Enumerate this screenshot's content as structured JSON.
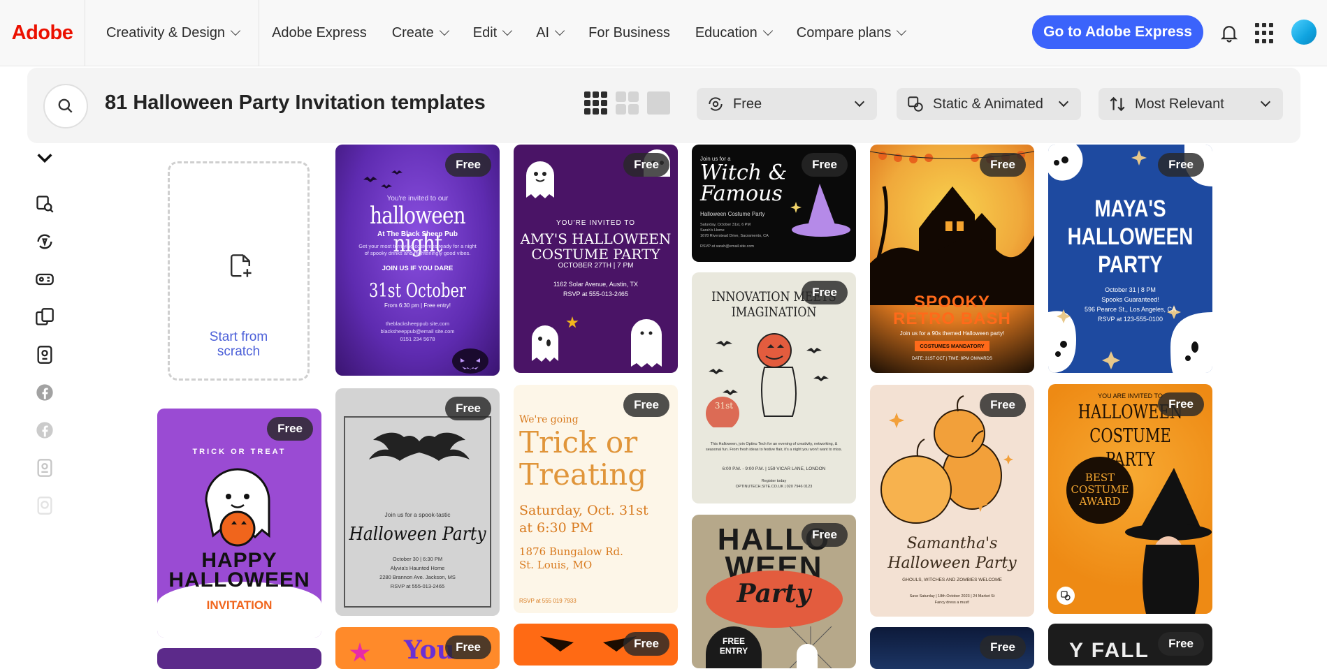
{
  "brand": {
    "logo_text": "Adobe",
    "accent": "#eb1000",
    "cta_color": "#3b63fb"
  },
  "nav": {
    "items": [
      {
        "label": "Creativity & Design",
        "has_menu": true
      },
      {
        "label": "Adobe Express",
        "has_menu": false
      },
      {
        "label": "Create",
        "has_menu": true
      },
      {
        "label": "Edit",
        "has_menu": true
      },
      {
        "label": "AI",
        "has_menu": true
      },
      {
        "label": "For Business",
        "has_menu": false
      },
      {
        "label": "Education",
        "has_menu": true
      },
      {
        "label": "Compare plans",
        "has_menu": true
      }
    ],
    "cta_label": "Go to Adobe Express",
    "icons": [
      "bell-icon",
      "app-grid-icon",
      "avatar"
    ]
  },
  "search": {
    "title": "81 Halloween Party Invitation templates",
    "view_modes": [
      "large-grid",
      "medium-grid",
      "small-grid"
    ],
    "filters": {
      "price": "Free",
      "type": "Static & Animated",
      "sort": "Most Relevant"
    }
  },
  "rail": {
    "icons": [
      "collapse-chevron-icon",
      "search-templates-icon",
      "premium-icon",
      "animated-icon",
      "template-type-icon",
      "image-icon",
      "facebook-icon",
      "facebook-alt-icon",
      "portrait-icon",
      "story-icon"
    ]
  },
  "scratch": {
    "label_line1": "Start from",
    "label_line2": "scratch"
  },
  "badge_label": "Free",
  "cards": {
    "halloween_night": {
      "intro": "You're invited to our",
      "title": "halloween night",
      "venue": "At The Black Sheep Pub",
      "body": "Get your most terrifying costumes ready for a night of spooky drinks and frighteningly good vibes.",
      "cta": "JOIN US IF YOU DARE",
      "date": "31st October",
      "time": "From 6:30 pm | Free entry!",
      "contact1": "theblacksheeppub site.com",
      "contact2": "blacksheeppub@email site.com",
      "contact3": "0151 234 5678"
    },
    "amys_party": {
      "intro": "YOU'RE INVITED TO",
      "title1": "AMY'S HALLOWEEN",
      "title2": "COSTUME PARTY",
      "date": "OCTOBER 27TH | 7 PM",
      "address": "1162 Solar Avenue, Austin, TX",
      "rsvp": "RSVP at 555-013-2465"
    },
    "witch_famous": {
      "intro": "Join us for a",
      "title1": "Witch &",
      "title2": "Famous",
      "subtitle": "Halloween Costume Party",
      "details1": "Saturday, October 31st, 6 PM",
      "details2": "Sarah's Home",
      "details3": "1678 Riverstead Drive, Sacramento, CA",
      "rsvp": "RSVP at sarah@email.site.com"
    },
    "spooky_retro": {
      "title1": "SPOOKY",
      "title2": "RETRO BASH",
      "sub": "Join us for a 90s themed Halloween party!",
      "tag": "COSTUMES MANDATORY",
      "footer": "DATE: 31ST OCT | TIME: 8PM ONWARDS"
    },
    "mayas_party": {
      "title1": "MAYA'S",
      "title2": "HALLOWEEN",
      "title3": "PARTY",
      "date": "October 31 | 8 PM",
      "sub": "Spooks Guaranteed!",
      "address": "596 Pearce St., Los Angeles, CA",
      "rsvp": "RSVP at 123-555-0100"
    },
    "innovation": {
      "title1": "INNOVATION MEETS",
      "title2": "IMAGINATION",
      "stamp": "31st",
      "body": "This Halloween, join Optinu Tech for an evening of creativity, networking, & seasonal fun. From fresh ideas to festive flair, it's a night you won't want to miss.",
      "details": "6:00 P.M. - 9:00 P.M. | 159 VICAR LANE, LONDON",
      "rsvp1": "Register today",
      "rsvp2": "OPTINUTECH.SITE.CO.UK | 020 7946 0123"
    },
    "happy_halloween": {
      "arc": "TRICK OR TREAT",
      "title1": "HAPPY",
      "title2": "HALLOWEEN",
      "sub": "INVITATION"
    },
    "bat_party": {
      "intro": "Join us for a spook-tastic",
      "title": "Halloween Party",
      "date": "October 30 | 6:30 PM",
      "venue": "Alyvia's Haunted Home",
      "address": "2280 Brannon Ave. Jackson, MS",
      "rsvp": "RSVP at 555-013-2465"
    },
    "trick_treating": {
      "intro": "We're going",
      "title1": "Trick or",
      "title2": "Treating",
      "date1": "Saturday, Oct. 31st",
      "date2": "at 6:30 PM",
      "address1": "1876 Bungalow Rd.",
      "address2": "St. Louis, MO",
      "rsvp": "RSVP at 555 019 7933"
    },
    "samanthas_party": {
      "title1": "Samantha's",
      "title2": "Halloween Party",
      "sub": "GHOULS, WITCHES AND ZOMBIES WELCOME",
      "details": "Save Saturday | 18th October 2023 | 24 Market St",
      "dress": "Fancy dress a must!"
    },
    "costume_party": {
      "intro": "YOU ARE INVITED TO",
      "title1": "HALLOWEEN",
      "title2": "COSTUME PARTY",
      "award1": "BEST",
      "award2": "COSTUME",
      "award3": "AWARD"
    },
    "hallo_ween": {
      "title1": "HALLO",
      "title2": "WEEN",
      "title3": "Party",
      "tag1": "FREE",
      "tag2": "ENTRY"
    },
    "you_card": {
      "title": "You"
    },
    "fall_card": {
      "title": "Y FALL"
    }
  }
}
